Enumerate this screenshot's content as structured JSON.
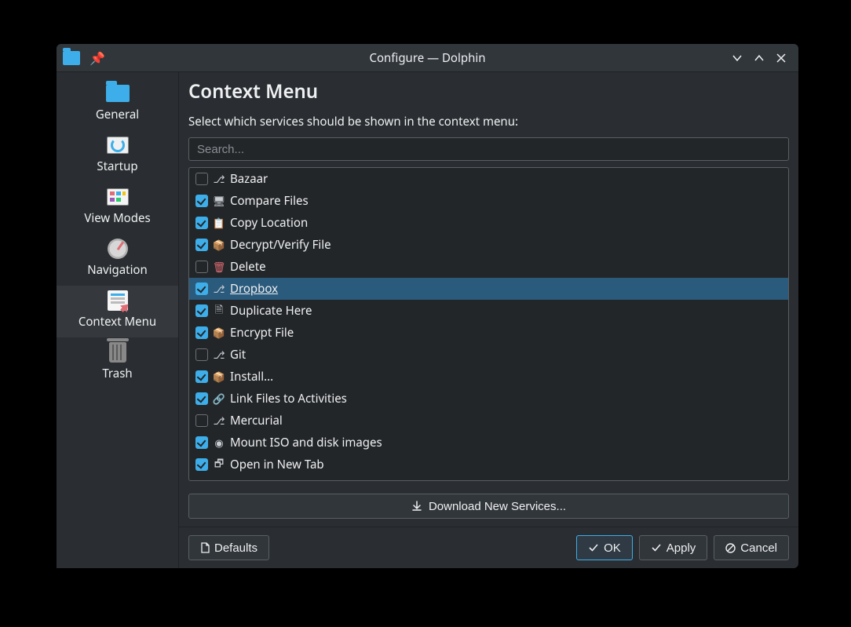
{
  "window_title": "Configure — Dolphin",
  "sidebar": {
    "items": [
      {
        "label": "General",
        "icon": "folder-icon",
        "selected": false
      },
      {
        "label": "Startup",
        "icon": "startup-icon",
        "selected": false
      },
      {
        "label": "View Modes",
        "icon": "viewmodes-icon",
        "selected": false
      },
      {
        "label": "Navigation",
        "icon": "nav-icon",
        "selected": false
      },
      {
        "label": "Context Menu",
        "icon": "ctx-icon",
        "selected": true
      },
      {
        "label": "Trash",
        "icon": "trash-icon",
        "selected": false
      }
    ]
  },
  "page": {
    "title": "Context Menu",
    "instruction": "Select which services should be shown in the context menu:",
    "search_placeholder": "Search..."
  },
  "services": [
    {
      "label": "Bazaar",
      "checked": false,
      "icon": "vcs-icon",
      "selected": false
    },
    {
      "label": "Compare Files",
      "checked": true,
      "icon": "compare-icon",
      "selected": false
    },
    {
      "label": "Copy Location",
      "checked": true,
      "icon": "copy-icon",
      "selected": false
    },
    {
      "label": "Decrypt/Verify File",
      "checked": true,
      "icon": "decrypt-icon",
      "selected": false
    },
    {
      "label": "Delete",
      "checked": false,
      "icon": "delete-icon",
      "selected": false
    },
    {
      "label": "Dropbox",
      "checked": true,
      "icon": "dropbox-icon",
      "selected": true
    },
    {
      "label": "Duplicate Here",
      "checked": true,
      "icon": "duplicate-icon",
      "selected": false
    },
    {
      "label": "Encrypt File",
      "checked": true,
      "icon": "encrypt-icon",
      "selected": false
    },
    {
      "label": "Git",
      "checked": false,
      "icon": "vcs-icon",
      "selected": false
    },
    {
      "label": "Install...",
      "checked": true,
      "icon": "install-icon",
      "selected": false
    },
    {
      "label": "Link Files to Activities",
      "checked": true,
      "icon": "link-icon",
      "selected": false
    },
    {
      "label": "Mercurial",
      "checked": false,
      "icon": "vcs-icon",
      "selected": false
    },
    {
      "label": "Mount ISO and disk images",
      "checked": true,
      "icon": "mount-icon",
      "selected": false
    },
    {
      "label": "Open in New Tab",
      "checked": true,
      "icon": "newtab-icon",
      "selected": false
    }
  ],
  "download_button": "Download New Services...",
  "footer": {
    "defaults": "Defaults",
    "ok": "OK",
    "apply": "Apply",
    "cancel": "Cancel"
  }
}
